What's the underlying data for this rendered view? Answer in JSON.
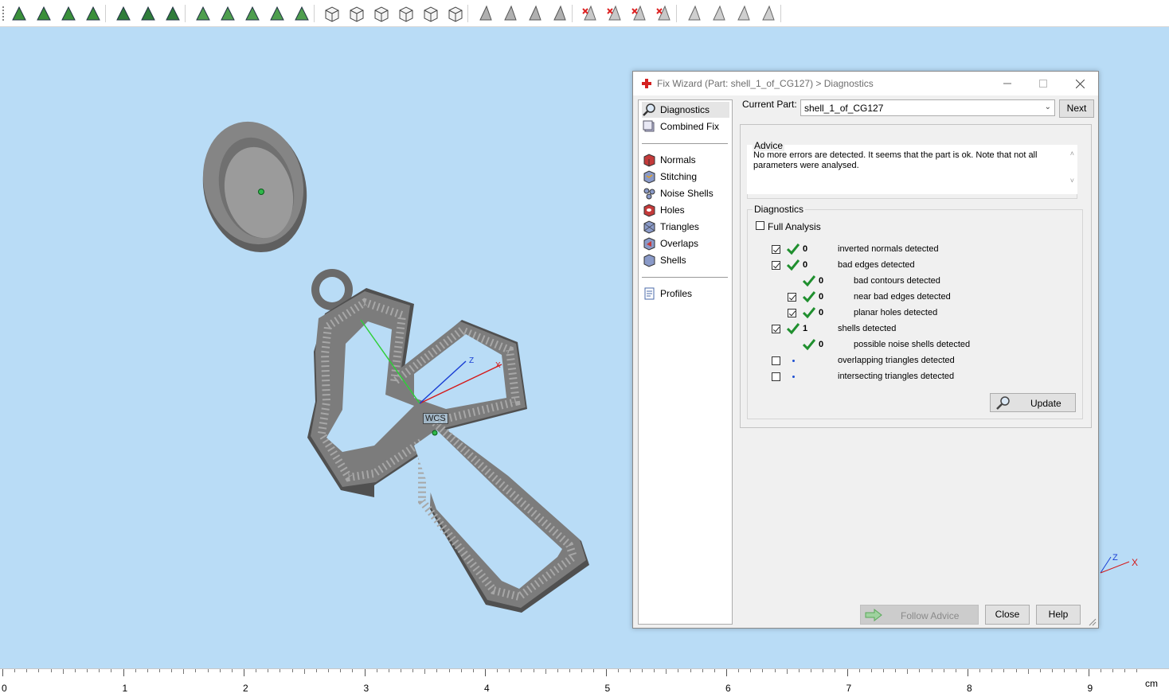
{
  "toolbar": {
    "groups": [
      [
        "select-triangle-icon",
        "select-surface-icon",
        "select-shell-icon",
        "select-part-icon"
      ],
      [
        "select-box-icon",
        "select-connected-icon",
        "select-curve-icon"
      ],
      [
        "select-plane-icon",
        "select-sphere-icon",
        "select-star-icon",
        "select-circle-icon",
        "select-ring-icon"
      ],
      [
        "view-front-icon",
        "view-back-icon",
        "view-left-icon",
        "view-right-icon",
        "view-top-icon",
        "view-iso-icon"
      ],
      [
        "measure-point-icon",
        "measure-edge-icon",
        "measure-angle-icon",
        "measure-face-icon"
      ],
      [
        "delete-mark-icon",
        "mark-plane-icon",
        "mark-surface-icon",
        "mark-shell-icon"
      ],
      [
        "shade-icon",
        "shade-blue-icon",
        "shade-mesh-icon",
        "shade-grey-icon"
      ]
    ]
  },
  "viewport": {
    "wcs_label": "WCS",
    "axis_labels": {
      "x": "X",
      "z": "Z"
    }
  },
  "ruler": {
    "ticks": [
      "0",
      "1",
      "2",
      "3",
      "4",
      "5",
      "6",
      "7",
      "8",
      "9"
    ],
    "unit": "cm"
  },
  "dialog": {
    "title": "Fix Wizard (Part: shell_1_of_CG127) > Diagnostics",
    "nav": {
      "top": [
        {
          "label": "Diagnostics",
          "icon": "magnifier-icon",
          "selected": true
        },
        {
          "label": "Combined Fix",
          "icon": "combined-fix-icon",
          "selected": false
        }
      ],
      "middle": [
        {
          "label": "Normals",
          "icon": "normals-icon"
        },
        {
          "label": "Stitching",
          "icon": "stitching-icon"
        },
        {
          "label": "Noise Shells",
          "icon": "noise-shells-icon"
        },
        {
          "label": "Holes",
          "icon": "holes-icon"
        },
        {
          "label": "Triangles",
          "icon": "triangles-icon"
        },
        {
          "label": "Overlaps",
          "icon": "overlaps-icon"
        },
        {
          "label": "Shells",
          "icon": "shells-icon"
        }
      ],
      "bottom": [
        {
          "label": "Profiles",
          "icon": "profiles-icon"
        }
      ]
    },
    "current_part_label": "Current Part:",
    "current_part_value": "shell_1_of_CG127",
    "next_label": "Next",
    "advice_title": "Advice",
    "advice_text": "No more errors are detected. It seems that the part is ok. Note that not all parameters were analysed.",
    "diagnostics_title": "Diagnostics",
    "full_analysis_label": "Full Analysis",
    "full_analysis_checked": false,
    "rows": [
      {
        "checkbox": true,
        "checked": true,
        "status": "ok",
        "count": "0",
        "label": "inverted normals detected",
        "indent": 0
      },
      {
        "checkbox": true,
        "checked": true,
        "status": "ok",
        "count": "0",
        "label": "bad edges detected",
        "indent": 0
      },
      {
        "checkbox": false,
        "checked": false,
        "status": "ok",
        "count": "0",
        "label": "bad contours detected",
        "indent": 1
      },
      {
        "checkbox": true,
        "checked": true,
        "status": "ok",
        "count": "0",
        "label": "near bad edges detected",
        "indent": 1
      },
      {
        "checkbox": true,
        "checked": true,
        "status": "ok",
        "count": "0",
        "label": "planar holes detected",
        "indent": 1
      },
      {
        "checkbox": true,
        "checked": true,
        "status": "ok",
        "count": "1",
        "label": "shells detected",
        "indent": 0
      },
      {
        "checkbox": false,
        "checked": false,
        "status": "ok",
        "count": "0",
        "label": "possible noise shells detected",
        "indent": 1
      },
      {
        "checkbox": true,
        "checked": false,
        "status": "pending",
        "count": "",
        "label": "overlapping triangles detected",
        "indent": 0
      },
      {
        "checkbox": true,
        "checked": false,
        "status": "pending",
        "count": "",
        "label": "intersecting triangles detected",
        "indent": 0
      }
    ],
    "update_label": "Update",
    "follow_advice_label": "Follow Advice",
    "close_label": "Close",
    "help_label": "Help"
  },
  "colors": {
    "viewport_bg": "#b9dcf6",
    "check_green": "#1f8f2e",
    "model_grey": "#6e6e6e"
  }
}
